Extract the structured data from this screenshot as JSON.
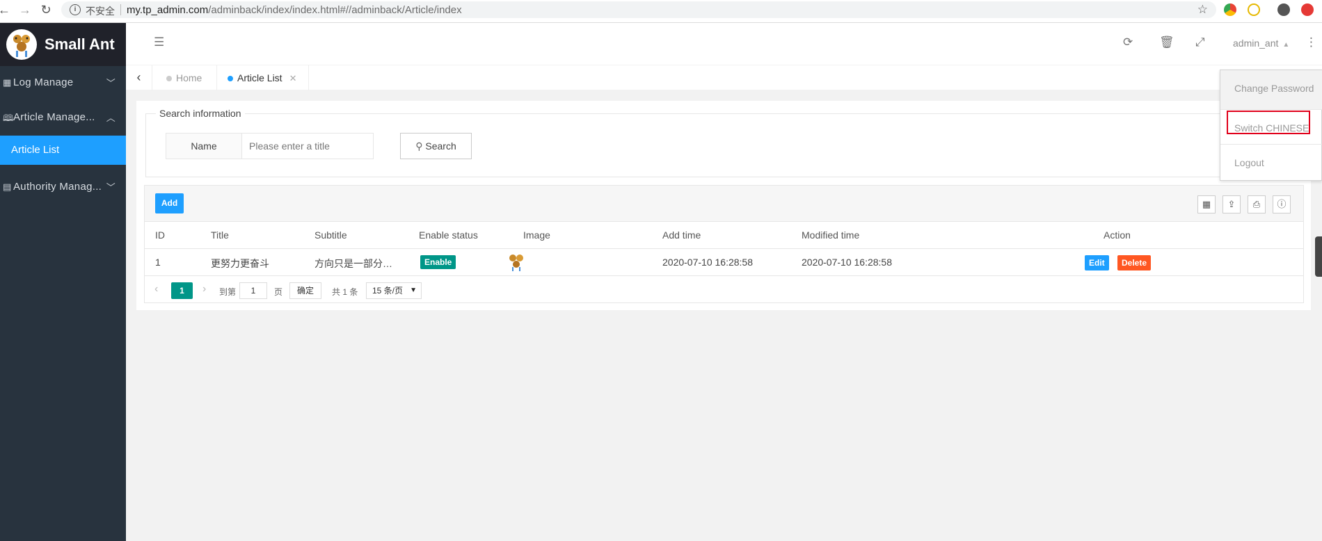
{
  "browser": {
    "security_label": "不安全",
    "url_host": "my.tp_admin.com",
    "url_path": "/adminback/index/index.html#//adminback/Article/index"
  },
  "sidebar": {
    "app_title": "Small Ant",
    "items": [
      {
        "label": "Log Manage",
        "icon": "table-icon",
        "expanded": false
      },
      {
        "label": "Article Manage...",
        "icon": "book-icon",
        "expanded": true
      },
      {
        "label": "Authority Manag...",
        "icon": "user-list-icon",
        "expanded": false
      }
    ],
    "active_subitem": "Article List"
  },
  "header": {
    "username": "admin_ant"
  },
  "tabs": [
    {
      "label": "Home",
      "active": false
    },
    {
      "label": "Article List",
      "active": true
    }
  ],
  "search": {
    "legend": "Search information",
    "name_label": "Name",
    "placeholder": "Please enter a title",
    "button_label": "Search"
  },
  "table": {
    "add_label": "Add",
    "columns": [
      "ID",
      "Title",
      "Subtitle",
      "Enable status",
      "Image",
      "Add time",
      "Modified time",
      "Action"
    ],
    "rows": [
      {
        "id": "1",
        "title": "更努力更奋斗",
        "subtitle": "方向只是一部分…",
        "status": "Enable",
        "add_time": "2020-07-10 16:28:58",
        "modified_time": "2020-07-10 16:28:58",
        "edit_label": "Edit",
        "delete_label": "Delete"
      }
    ]
  },
  "pager": {
    "current_page": "1",
    "goto_label": "到第",
    "goto_value": "1",
    "page_unit": "页",
    "ok_label": "确定",
    "total_label": "共 1 条",
    "per_page": "15 条/页"
  },
  "dropdown": {
    "items": [
      "Change Password",
      "Switch CHINESE",
      "Logout"
    ]
  },
  "colors": {
    "sidebar_bg": "#28333e",
    "accent_blue": "#1e9fff",
    "accent_teal": "#009688",
    "danger_orange": "#ff5722",
    "highlight_red": "#e0001a"
  }
}
